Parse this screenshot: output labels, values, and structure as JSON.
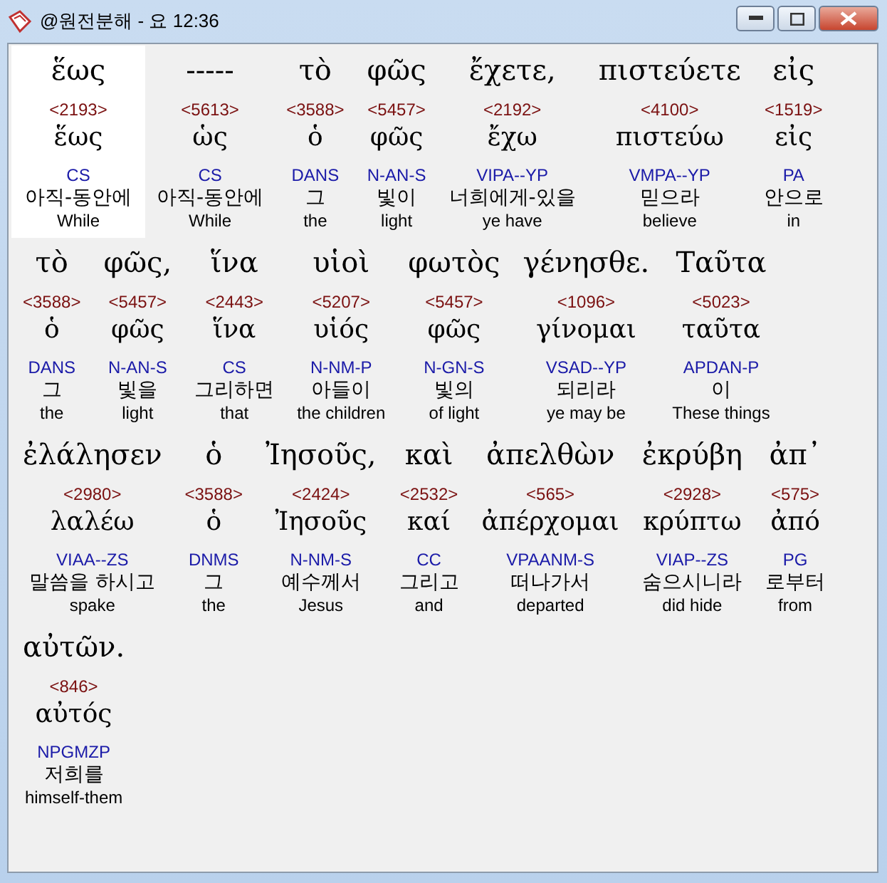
{
  "window": {
    "title": "@원전분해 - 요 12:36"
  },
  "lines": [
    [
      {
        "greek": "ἕως",
        "strong": "<2193>",
        "lemma": "ἕως",
        "morph": "CS",
        "korean": "아직-동안에",
        "english": "While",
        "selected": true
      },
      {
        "greek": "-----",
        "strong": "<5613>",
        "lemma": "ὡς",
        "morph": "CS",
        "korean": "아직-동안에",
        "english": "While",
        "selected": false
      },
      {
        "greek": "τὸ",
        "strong": "<3588>",
        "lemma": "ὁ",
        "morph": "DANS",
        "korean": "그",
        "english": "the",
        "selected": false
      },
      {
        "greek": "φῶς",
        "strong": "<5457>",
        "lemma": "φῶς",
        "morph": "N-AN-S",
        "korean": "빛이",
        "english": "light",
        "selected": false
      },
      {
        "greek": "ἔχετε,",
        "strong": "<2192>",
        "lemma": "ἔχω",
        "morph": "VIPA--YP",
        "korean": "너희에게-있을",
        "english": "ye have",
        "selected": false
      },
      {
        "greek": "πιστεύετε",
        "strong": "<4100>",
        "lemma": "πιστεύω",
        "morph": "VMPA--YP",
        "korean": "믿으라",
        "english": "believe",
        "selected": false
      },
      {
        "greek": "εἰς",
        "strong": "<1519>",
        "lemma": "εἰς",
        "morph": "PA",
        "korean": "안으로",
        "english": "in",
        "selected": false
      }
    ],
    [
      {
        "greek": "τὸ",
        "strong": "<3588>",
        "lemma": "ὁ",
        "morph": "DANS",
        "korean": "그",
        "english": "the",
        "selected": false
      },
      {
        "greek": "φῶς,",
        "strong": "<5457>",
        "lemma": "φῶς",
        "morph": "N-AN-S",
        "korean": "빛을",
        "english": "light",
        "selected": false
      },
      {
        "greek": "ἵνα",
        "strong": "<2443>",
        "lemma": "ἵνα",
        "morph": "CS",
        "korean": "그리하면",
        "english": "that",
        "selected": false
      },
      {
        "greek": "υἱοὶ",
        "strong": "<5207>",
        "lemma": "υἱός",
        "morph": "N-NM-P",
        "korean": "아들이",
        "english": "the children",
        "selected": false
      },
      {
        "greek": "φωτὸς",
        "strong": "<5457>",
        "lemma": "φῶς",
        "morph": "N-GN-S",
        "korean": "빛의",
        "english": "of light",
        "selected": false
      },
      {
        "greek": "γένησθε.",
        "strong": "<1096>",
        "lemma": "γίνομαι",
        "morph": "VSAD--YP",
        "korean": "되리라",
        "english": "ye may be",
        "selected": false
      },
      {
        "greek": "Ταῦτα",
        "strong": "<5023>",
        "lemma": "ταῦτα",
        "morph": "APDAN-P",
        "korean": "이",
        "english": "These things",
        "selected": false
      }
    ],
    [
      {
        "greek": "ἐλάλησεν",
        "strong": "<2980>",
        "lemma": "λαλέω",
        "morph": "VIAA--ZS",
        "korean": "말씀을 하시고",
        "english": "spake",
        "selected": false
      },
      {
        "greek": "ὁ",
        "strong": "<3588>",
        "lemma": "ὁ",
        "morph": "DNMS",
        "korean": "그",
        "english": "the",
        "selected": false
      },
      {
        "greek": "Ἰησοῦς,",
        "strong": "<2424>",
        "lemma": "Ἰησοῦς",
        "morph": "N-NM-S",
        "korean": "예수께서",
        "english": "Jesus",
        "selected": false
      },
      {
        "greek": "καὶ",
        "strong": "<2532>",
        "lemma": "καί",
        "morph": "CC",
        "korean": "그리고",
        "english": "and",
        "selected": false
      },
      {
        "greek": "ἀπελθὼν",
        "strong": "<565>",
        "lemma": "ἀπέρχομαι",
        "morph": "VPAANM-S",
        "korean": "떠나가서",
        "english": "departed",
        "selected": false
      },
      {
        "greek": "ἐκρύβη",
        "strong": "<2928>",
        "lemma": "κρύπτω",
        "morph": "VIAP--ZS",
        "korean": "숨으시니라",
        "english": "did hide",
        "selected": false
      },
      {
        "greek": "ἀπ᾽",
        "strong": "<575>",
        "lemma": "ἀπό",
        "morph": "PG",
        "korean": "로부터",
        "english": "from",
        "selected": false
      }
    ],
    [
      {
        "greek": "αὐτῶν.",
        "strong": "<846>",
        "lemma": "αὐτός",
        "morph": "NPGMZP",
        "korean": "저희를",
        "english": "himself-them",
        "selected": false
      }
    ]
  ]
}
